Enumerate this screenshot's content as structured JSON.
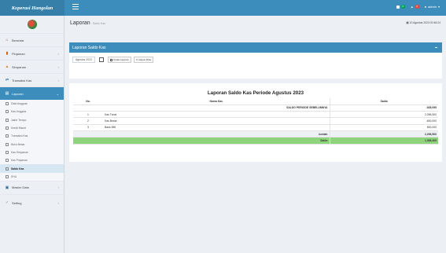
{
  "app": {
    "brand": "Koperasi Hangolan"
  },
  "topbar": {
    "mail_badge": "0",
    "notif_badge": "0",
    "user_label": "admin"
  },
  "sidebar": {
    "items": [
      {
        "label": "Beranda"
      },
      {
        "label": "Pinjaman"
      },
      {
        "label": "Simpanan"
      },
      {
        "label": "Transaksi Kas"
      },
      {
        "label": "Laporan"
      }
    ],
    "submenu": [
      {
        "label": "Data Anggota"
      },
      {
        "label": "Kas Anggota"
      },
      {
        "label": "Jatuh Tempo"
      },
      {
        "label": "Kredit Macet"
      },
      {
        "label": "Transaksi Kas"
      },
      {
        "label": "Buku Besar"
      },
      {
        "label": "Kas Simpanan"
      },
      {
        "label": "Kas Pinjaman"
      },
      {
        "label": "Saldo Kas"
      },
      {
        "label": "SHU"
      }
    ],
    "bottom": [
      {
        "label": "Master Data"
      },
      {
        "label": "Setting"
      }
    ]
  },
  "page": {
    "title": "Laporan",
    "subtitle": "Saldo Kas",
    "datetime": "10 Agustus 2023  02:46:24"
  },
  "box": {
    "title": "Laporan Saldo Kas",
    "period_value": "Agustus 2023",
    "print_label": "Cetak Laporan",
    "clear_label": "Hapus Filter"
  },
  "report": {
    "title": "Laporan Saldo Kas Periode Agustus 2023",
    "headers": {
      "no": "No.",
      "name": "Nama Kas",
      "amount": "Saldo"
    },
    "previous_label": "SALDO PERIODE SEBELUMNYA",
    "previous_value": "-928,095",
    "rows": [
      {
        "no": "1",
        "name": "Kas Tunai",
        "amount": "2,096,500"
      },
      {
        "no": "2",
        "name": "Kas Besar",
        "amount": "-600,000"
      },
      {
        "no": "3",
        "name": "Bank BNI",
        "amount": "800,000"
      }
    ],
    "total_label": "Jumlah",
    "total_value": "2,296,500",
    "saldo_label": "Saldo",
    "saldo_value": "1,368,405"
  }
}
